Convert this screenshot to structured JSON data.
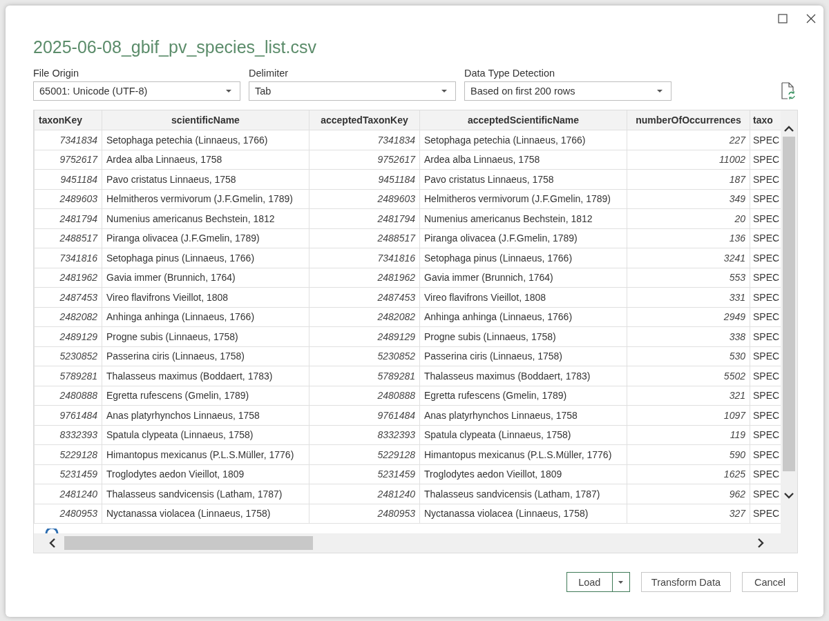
{
  "window": {
    "title": "2025-06-08_gbif_pv_species_list.csv"
  },
  "options": [
    {
      "label": "File Origin",
      "value": "65001: Unicode (UTF-8)"
    },
    {
      "label": "Delimiter",
      "value": "Tab"
    },
    {
      "label": "Data Type Detection",
      "value": "Based on first 200 rows"
    }
  ],
  "table": {
    "columns": [
      {
        "name": "taxonKey",
        "kind": "number"
      },
      {
        "name": "scientificName",
        "kind": "text"
      },
      {
        "name": "acceptedTaxonKey",
        "kind": "number"
      },
      {
        "name": "acceptedScientificName",
        "kind": "text"
      },
      {
        "name": "numberOfOccurrences",
        "kind": "number"
      },
      {
        "name": "taxo",
        "kind": "text"
      }
    ],
    "rows": [
      [
        "7341834",
        "Setophaga petechia (Linnaeus, 1766)",
        "7341834",
        "Setophaga petechia (Linnaeus, 1766)",
        "227",
        "SPEC"
      ],
      [
        "9752617",
        "Ardea alba Linnaeus, 1758",
        "9752617",
        "Ardea alba Linnaeus, 1758",
        "11002",
        "SPEC"
      ],
      [
        "9451184",
        "Pavo cristatus Linnaeus, 1758",
        "9451184",
        "Pavo cristatus Linnaeus, 1758",
        "187",
        "SPEC"
      ],
      [
        "2489603",
        "Helmitheros vermivorum (J.F.Gmelin, 1789)",
        "2489603",
        "Helmitheros vermivorum (J.F.Gmelin, 1789)",
        "349",
        "SPEC"
      ],
      [
        "2481794",
        "Numenius americanus Bechstein, 1812",
        "2481794",
        "Numenius americanus Bechstein, 1812",
        "20",
        "SPEC"
      ],
      [
        "2488517",
        "Piranga olivacea (J.F.Gmelin, 1789)",
        "2488517",
        "Piranga olivacea (J.F.Gmelin, 1789)",
        "136",
        "SPEC"
      ],
      [
        "7341816",
        "Setophaga pinus (Linnaeus, 1766)",
        "7341816",
        "Setophaga pinus (Linnaeus, 1766)",
        "3241",
        "SPEC"
      ],
      [
        "2481962",
        "Gavia immer (Brunnich, 1764)",
        "2481962",
        "Gavia immer (Brunnich, 1764)",
        "553",
        "SPEC"
      ],
      [
        "2487453",
        "Vireo flavifrons Vieillot, 1808",
        "2487453",
        "Vireo flavifrons Vieillot, 1808",
        "331",
        "SPEC"
      ],
      [
        "2482082",
        "Anhinga anhinga (Linnaeus, 1766)",
        "2482082",
        "Anhinga anhinga (Linnaeus, 1766)",
        "2949",
        "SPEC"
      ],
      [
        "2489129",
        "Progne subis (Linnaeus, 1758)",
        "2489129",
        "Progne subis (Linnaeus, 1758)",
        "338",
        "SPEC"
      ],
      [
        "5230852",
        "Passerina ciris (Linnaeus, 1758)",
        "5230852",
        "Passerina ciris (Linnaeus, 1758)",
        "530",
        "SPEC"
      ],
      [
        "5789281",
        "Thalasseus maximus (Boddaert, 1783)",
        "5789281",
        "Thalasseus maximus (Boddaert, 1783)",
        "5502",
        "SPEC"
      ],
      [
        "2480888",
        "Egretta rufescens (Gmelin, 1789)",
        "2480888",
        "Egretta rufescens (Gmelin, 1789)",
        "321",
        "SPEC"
      ],
      [
        "9761484",
        "Anas platyrhynchos Linnaeus, 1758",
        "9761484",
        "Anas platyrhynchos Linnaeus, 1758",
        "1097",
        "SPEC"
      ],
      [
        "8332393",
        "Spatula clypeata (Linnaeus, 1758)",
        "8332393",
        "Spatula clypeata (Linnaeus, 1758)",
        "119",
        "SPEC"
      ],
      [
        "5229128",
        "Himantopus mexicanus (P.L.S.Müller, 1776)",
        "5229128",
        "Himantopus mexicanus (P.L.S.Müller, 1776)",
        "590",
        "SPEC"
      ],
      [
        "5231459",
        "Troglodytes aedon Vieillot, 1809",
        "5231459",
        "Troglodytes aedon Vieillot, 1809",
        "1625",
        "SPEC"
      ],
      [
        "2481240",
        "Thalasseus sandvicensis (Latham, 1787)",
        "2481240",
        "Thalasseus sandvicensis (Latham, 1787)",
        "962",
        "SPEC"
      ],
      [
        "2480953",
        "Nyctanassa violacea (Linnaeus, 1758)",
        "2480953",
        "Nyctanassa violacea (Linnaeus, 1758)",
        "327",
        "SPEC"
      ]
    ]
  },
  "buttons": [
    {
      "label": "Load",
      "kind": "split"
    },
    {
      "label": "Transform Data",
      "kind": "plain"
    },
    {
      "label": "Cancel",
      "kind": "plain"
    }
  ]
}
